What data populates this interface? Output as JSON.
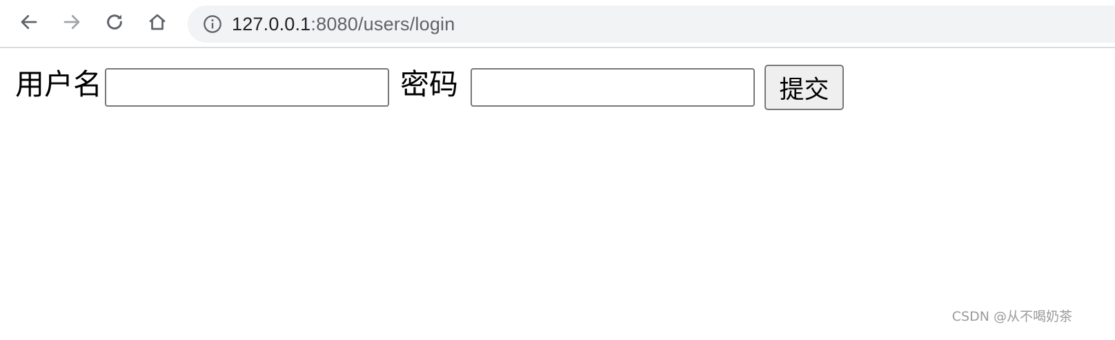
{
  "browser": {
    "back_icon": "arrow-left-icon",
    "forward_icon": "arrow-right-icon",
    "reload_icon": "reload-icon",
    "home_icon": "home-icon",
    "info_icon": "info-circle-icon",
    "url_host": "127.0.0.1",
    "url_rest": ":8080/users/login"
  },
  "form": {
    "username_label": "用户名",
    "username_value": "",
    "password_label": "密码",
    "password_value": "",
    "submit_label": "提交"
  },
  "watermark": "CSDN @从不喝奶茶",
  "colors": {
    "omnibox_bg": "#f1f3f4",
    "icon": "#5f6368",
    "icon_disabled": "#a0a4a8",
    "button_bg": "#efefef",
    "input_border": "#767676"
  }
}
